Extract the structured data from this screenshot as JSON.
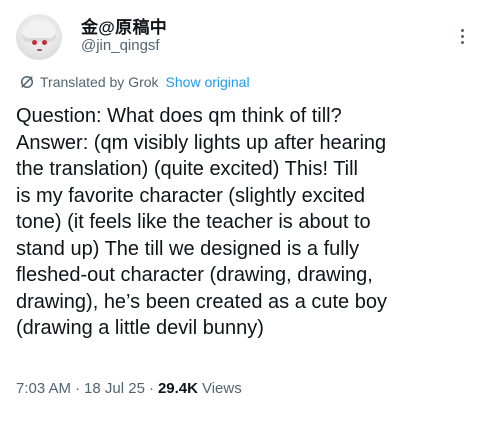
{
  "post": {
    "author": {
      "display_name": "金@原稿中",
      "handle": "@jin_qingsf"
    },
    "translation": {
      "label": "Translated by Grok",
      "show_original_label": "Show original",
      "icon": "grok-icon"
    },
    "body_lines": [
      "Question: What does qm think of till?",
      "Answer: (qm visibly lights up after hearing",
      "the translation) (quite excited) This! Till",
      "is my favorite character (slightly excited",
      "tone) (it feels like the teacher is about to",
      "stand up) The till we designed is a fully",
      "fleshed-out character (drawing, drawing,",
      "drawing), he’s been created as a cute boy",
      "(drawing a little devil bunny)"
    ],
    "meta": {
      "time": "7:03 AM",
      "separator": "·",
      "date": "18 Jul 25",
      "views_count": "29.4K",
      "views_label": "Views"
    },
    "more_icon": "more-vertical-icon"
  },
  "colors": {
    "text_primary": "#0f1419",
    "text_secondary": "#536471",
    "link": "#1d9bf0",
    "background": "#ffffff"
  }
}
